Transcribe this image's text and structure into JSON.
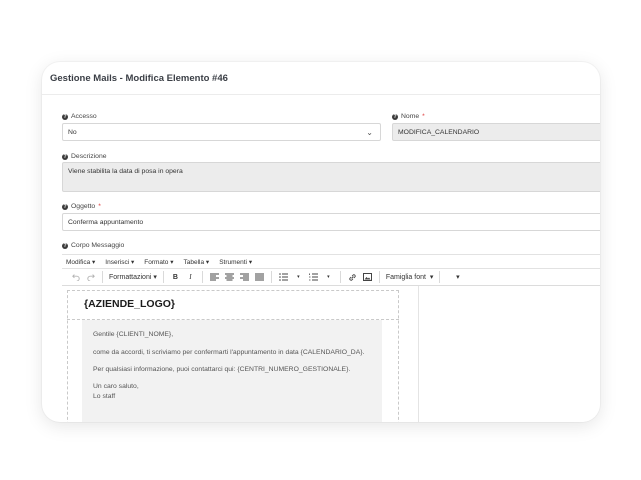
{
  "header": {
    "title": "Gestione Mails - Modifica Elemento #46"
  },
  "form": {
    "accesso": {
      "label": "Accesso",
      "value": "No"
    },
    "nome": {
      "label": "Nome",
      "required_mark": "*",
      "value": "MODIFICA_CALENDARIO"
    },
    "descrizione": {
      "label": "Descrizione",
      "value": "Viene stabilita la data di posa in opera"
    },
    "oggetto": {
      "label": "Oggetto",
      "required_mark": "*",
      "value": "Conferma appuntamento"
    },
    "corpo": {
      "label": "Corpo Messaggio"
    }
  },
  "editor": {
    "menus": [
      "Modifica",
      "Inserisci",
      "Formato",
      "Tabella",
      "Strumenti"
    ],
    "toolbar": {
      "formats_label": "Formattazioni",
      "bold_label": "B",
      "italic_label": "I",
      "font_family_label": "Famiglia font"
    },
    "content": {
      "logo": "{AZIENDE_LOGO}",
      "greeting": "Gentile {CLIENTI_NOME},",
      "line1": "come da accordi, ti scriviamo per confermarti l'appuntamento in data {CALENDARIO_DA}.",
      "line2": "Per qualsiasi informazione, puoi contattarci qui: {CENTRI_NUMERO_GESTIONALE}.",
      "closing1": "Un caro saluto,",
      "closing2": "Lo staff"
    }
  },
  "icons": {
    "help": "question-circle-icon",
    "dropdown": "chevron-down-icon",
    "undo": "undo-icon",
    "redo": "redo-icon",
    "link": "link-icon",
    "image": "image-icon"
  }
}
